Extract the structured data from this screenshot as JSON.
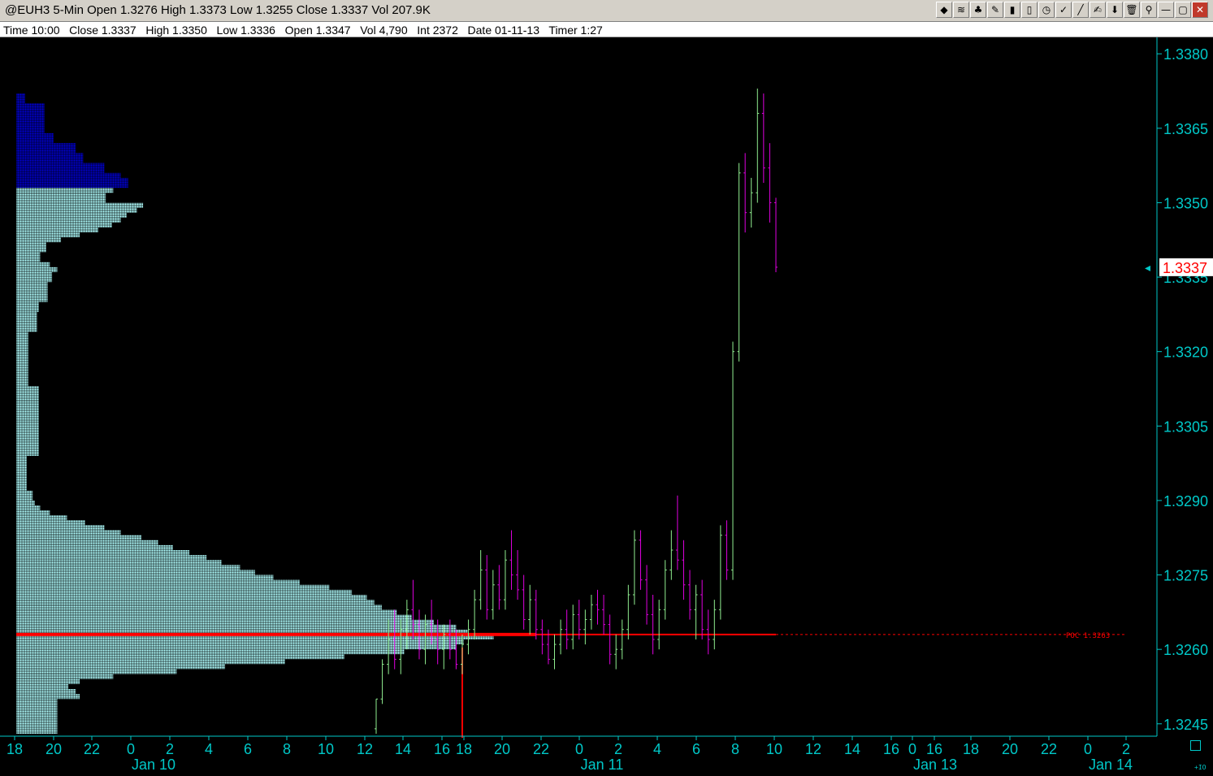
{
  "window": {
    "title": "@EUH3 5-Min Open 1.3276 High 1.3373 Low 1.3255 Close 1.3337 Vol 207.9K",
    "toolbar_icons": [
      "chart-icon",
      "wave-icon",
      "tree-icon",
      "pencil-icon",
      "bars-icon",
      "candle-icon",
      "clock-icon",
      "check-icon",
      "line-tool-icon",
      "draw-icon",
      "arrow-down-icon",
      "trash-icon",
      "pin-icon",
      "minimize-icon",
      "maximize-icon",
      "close-icon"
    ],
    "toolbar_glyphs": [
      "◆",
      "≋",
      "♣",
      "✎",
      "▮",
      "▯",
      "◷",
      "✓",
      "╱",
      "✍",
      "⬇",
      "🗑",
      "⚲",
      "—",
      "▢",
      "✕"
    ]
  },
  "infobar": {
    "text": "Time 10:00   Close 1.3337   High 1.3350   Low 1.3336   Open 1.3347   Vol 4,790   Int 2372   Date 01-11-13   Timer 1:27"
  },
  "colors": {
    "background": "#000000",
    "axis": "#00c8c8",
    "profile_light": "#aefcfc",
    "profile_dark": "#0000d0",
    "up_bar": "#90ee90",
    "down_bar": "#e000e0",
    "poc_line": "#ff0000"
  },
  "chart_data": {
    "type": "candlestick-with-volume-profile",
    "symbol": "@EUH3",
    "interval": "5-Min",
    "ylim": [
      1.3243,
      1.3382
    ],
    "yticks": [
      "1.3380",
      "1.3365",
      "1.3350",
      "1.3335",
      "1.3320",
      "1.3305",
      "1.3290",
      "1.3275",
      "1.3260",
      "1.3245"
    ],
    "last_price": "1.3337",
    "last_price_value": 1.3337,
    "poc_label": "POC 1.3263",
    "poc_value": 1.3263,
    "xticks": [
      "18",
      "20",
      "22",
      "0",
      "2",
      "4",
      "6",
      "8",
      "10",
      "12",
      "14",
      "16",
      "18",
      "20",
      "22",
      "0",
      "2",
      "4",
      "6",
      "8",
      "10",
      "12",
      "14",
      "16",
      "0",
      "16",
      "18",
      "20",
      "22",
      "0",
      "2"
    ],
    "date_labels": [
      "Jan 10",
      "Jan 11",
      "Jan 13",
      "Jan 14"
    ],
    "volume_profile": [
      {
        "price": 1.3372,
        "volume": 12,
        "zone": "dark"
      },
      {
        "price": 1.337,
        "volume": 38,
        "zone": "dark"
      },
      {
        "price": 1.3368,
        "volume": 38,
        "zone": "dark"
      },
      {
        "price": 1.3366,
        "volume": 38,
        "zone": "dark"
      },
      {
        "price": 1.3364,
        "volume": 50,
        "zone": "dark"
      },
      {
        "price": 1.3362,
        "volume": 80,
        "zone": "dark"
      },
      {
        "price": 1.336,
        "volume": 90,
        "zone": "dark"
      },
      {
        "price": 1.3358,
        "volume": 118,
        "zone": "dark"
      },
      {
        "price": 1.3356,
        "volume": 140,
        "zone": "dark"
      },
      {
        "price": 1.3355,
        "volume": 150,
        "zone": "dark"
      },
      {
        "price": 1.3353,
        "volume": 130,
        "zone": "light"
      },
      {
        "price": 1.3352,
        "volume": 120,
        "zone": "light"
      },
      {
        "price": 1.335,
        "volume": 170,
        "zone": "light"
      },
      {
        "price": 1.3349,
        "volume": 162,
        "zone": "light"
      },
      {
        "price": 1.3348,
        "volume": 148,
        "zone": "light"
      },
      {
        "price": 1.3347,
        "volume": 140,
        "zone": "light"
      },
      {
        "price": 1.3346,
        "volume": 128,
        "zone": "light"
      },
      {
        "price": 1.3345,
        "volume": 110,
        "zone": "light"
      },
      {
        "price": 1.3344,
        "volume": 85,
        "zone": "light"
      },
      {
        "price": 1.3343,
        "volume": 60,
        "zone": "light"
      },
      {
        "price": 1.3342,
        "volume": 40,
        "zone": "light"
      },
      {
        "price": 1.334,
        "volume": 32,
        "zone": "light"
      },
      {
        "price": 1.3338,
        "volume": 45,
        "zone": "light"
      },
      {
        "price": 1.3337,
        "volume": 55,
        "zone": "light"
      },
      {
        "price": 1.3336,
        "volume": 48,
        "zone": "light"
      },
      {
        "price": 1.3334,
        "volume": 42,
        "zone": "light"
      },
      {
        "price": 1.3332,
        "volume": 42,
        "zone": "light"
      },
      {
        "price": 1.333,
        "volume": 30,
        "zone": "light"
      },
      {
        "price": 1.3328,
        "volume": 28,
        "zone": "light"
      },
      {
        "price": 1.3326,
        "volume": 28,
        "zone": "light"
      },
      {
        "price": 1.3324,
        "volume": 16,
        "zone": "light"
      },
      {
        "price": 1.332,
        "volume": 16,
        "zone": "light"
      },
      {
        "price": 1.3316,
        "volume": 16,
        "zone": "light"
      },
      {
        "price": 1.3313,
        "volume": 30,
        "zone": "light"
      },
      {
        "price": 1.331,
        "volume": 30,
        "zone": "light"
      },
      {
        "price": 1.3306,
        "volume": 30,
        "zone": "light"
      },
      {
        "price": 1.3302,
        "volume": 30,
        "zone": "light"
      },
      {
        "price": 1.3299,
        "volume": 14,
        "zone": "light"
      },
      {
        "price": 1.3295,
        "volume": 14,
        "zone": "light"
      },
      {
        "price": 1.3292,
        "volume": 22,
        "zone": "light"
      },
      {
        "price": 1.329,
        "volume": 25,
        "zone": "light"
      },
      {
        "price": 1.3289,
        "volume": 32,
        "zone": "light"
      },
      {
        "price": 1.3288,
        "volume": 45,
        "zone": "light"
      },
      {
        "price": 1.3287,
        "volume": 68,
        "zone": "light"
      },
      {
        "price": 1.3286,
        "volume": 92,
        "zone": "light"
      },
      {
        "price": 1.3285,
        "volume": 118,
        "zone": "light"
      },
      {
        "price": 1.3284,
        "volume": 140,
        "zone": "light"
      },
      {
        "price": 1.3283,
        "volume": 168,
        "zone": "light"
      },
      {
        "price": 1.3282,
        "volume": 190,
        "zone": "light"
      },
      {
        "price": 1.3281,
        "volume": 210,
        "zone": "light"
      },
      {
        "price": 1.328,
        "volume": 232,
        "zone": "light"
      },
      {
        "price": 1.3279,
        "volume": 255,
        "zone": "light"
      },
      {
        "price": 1.3278,
        "volume": 275,
        "zone": "light"
      },
      {
        "price": 1.3277,
        "volume": 300,
        "zone": "light"
      },
      {
        "price": 1.3276,
        "volume": 320,
        "zone": "light"
      },
      {
        "price": 1.3275,
        "volume": 345,
        "zone": "light"
      },
      {
        "price": 1.3274,
        "volume": 380,
        "zone": "light"
      },
      {
        "price": 1.3273,
        "volume": 420,
        "zone": "light"
      },
      {
        "price": 1.3272,
        "volume": 450,
        "zone": "light"
      },
      {
        "price": 1.3271,
        "volume": 470,
        "zone": "light"
      },
      {
        "price": 1.327,
        "volume": 480,
        "zone": "light"
      },
      {
        "price": 1.3269,
        "volume": 490,
        "zone": "light"
      },
      {
        "price": 1.3268,
        "volume": 510,
        "zone": "light"
      },
      {
        "price": 1.3267,
        "volume": 530,
        "zone": "light"
      },
      {
        "price": 1.3266,
        "volume": 560,
        "zone": "light"
      },
      {
        "price": 1.3265,
        "volume": 590,
        "zone": "light"
      },
      {
        "price": 1.3264,
        "volume": 605,
        "zone": "light"
      },
      {
        "price": 1.3263,
        "volume": 640,
        "zone": "light"
      },
      {
        "price": 1.3262,
        "volume": 600,
        "zone": "light"
      },
      {
        "price": 1.3261,
        "volume": 590,
        "zone": "light"
      },
      {
        "price": 1.326,
        "volume": 520,
        "zone": "light"
      },
      {
        "price": 1.3259,
        "volume": 440,
        "zone": "light"
      },
      {
        "price": 1.3258,
        "volume": 360,
        "zone": "light"
      },
      {
        "price": 1.3257,
        "volume": 280,
        "zone": "light"
      },
      {
        "price": 1.3256,
        "volume": 215,
        "zone": "light"
      },
      {
        "price": 1.3255,
        "volume": 130,
        "zone": "light"
      },
      {
        "price": 1.3254,
        "volume": 85,
        "zone": "light"
      },
      {
        "price": 1.3253,
        "volume": 70,
        "zone": "light"
      },
      {
        "price": 1.3252,
        "volume": 80,
        "zone": "light"
      },
      {
        "price": 1.3251,
        "volume": 85,
        "zone": "light"
      },
      {
        "price": 1.325,
        "volume": 55,
        "zone": "light"
      },
      {
        "price": 1.3248,
        "volume": 55,
        "zone": "light"
      },
      {
        "price": 1.3246,
        "volume": 55,
        "zone": "light"
      },
      {
        "price": 1.3244,
        "volume": 55,
        "zone": "light"
      }
    ],
    "bars": [
      [
        1.3244,
        1.325,
        1.3243,
        1.325
      ],
      [
        1.325,
        1.3258,
        1.3249,
        1.3257
      ],
      [
        1.3257,
        1.3266,
        1.3255,
        1.3262
      ],
      [
        1.3262,
        1.3268,
        1.3256,
        1.3258
      ],
      [
        1.3258,
        1.3266,
        1.3255,
        1.3264
      ],
      [
        1.3264,
        1.327,
        1.326,
        1.3268
      ],
      [
        1.3268,
        1.3274,
        1.3262,
        1.3265
      ],
      [
        1.3265,
        1.3268,
        1.3258,
        1.326
      ],
      [
        1.326,
        1.3267,
        1.3257,
        1.3265
      ],
      [
        1.3265,
        1.327,
        1.3261,
        1.3262
      ],
      [
        1.3262,
        1.3266,
        1.3257,
        1.326
      ],
      [
        1.326,
        1.3265,
        1.3256,
        1.3263
      ],
      [
        1.3263,
        1.3266,
        1.3258,
        1.326
      ],
      [
        1.326,
        1.3264,
        1.3256,
        1.3257
      ],
      [
        1.3257,
        1.3263,
        1.3255,
        1.3261
      ],
      [
        1.3261,
        1.3266,
        1.3259,
        1.3264
      ],
      [
        1.3264,
        1.3272,
        1.3262,
        1.327
      ],
      [
        1.327,
        1.328,
        1.3268,
        1.3276
      ],
      [
        1.3276,
        1.3279,
        1.3266,
        1.3268
      ],
      [
        1.3268,
        1.3276,
        1.3266,
        1.3273
      ],
      [
        1.3273,
        1.3277,
        1.3268,
        1.327
      ],
      [
        1.327,
        1.328,
        1.3268,
        1.3278
      ],
      [
        1.3278,
        1.3284,
        1.3272,
        1.3275
      ],
      [
        1.3275,
        1.328,
        1.327,
        1.3272
      ],
      [
        1.3272,
        1.3275,
        1.3264,
        1.3266
      ],
      [
        1.3266,
        1.3273,
        1.3263,
        1.327
      ],
      [
        1.327,
        1.3272,
        1.3262,
        1.3264
      ],
      [
        1.3264,
        1.3266,
        1.3259,
        1.3261
      ],
      [
        1.3261,
        1.3264,
        1.3257,
        1.3258
      ],
      [
        1.3258,
        1.3263,
        1.3256,
        1.3261
      ],
      [
        1.3261,
        1.3266,
        1.3259,
        1.3264
      ],
      [
        1.3264,
        1.3268,
        1.326,
        1.3262
      ],
      [
        1.3262,
        1.3269,
        1.326,
        1.3267
      ],
      [
        1.3267,
        1.327,
        1.3262,
        1.3264
      ],
      [
        1.3264,
        1.3268,
        1.3261,
        1.3266
      ],
      [
        1.3266,
        1.3271,
        1.3264,
        1.3269
      ],
      [
        1.3269,
        1.3272,
        1.3265,
        1.3268
      ],
      [
        1.3268,
        1.3271,
        1.3263,
        1.3265
      ],
      [
        1.3265,
        1.3267,
        1.3257,
        1.3259
      ],
      [
        1.3259,
        1.3263,
        1.3256,
        1.326
      ],
      [
        1.326,
        1.3266,
        1.3258,
        1.3264
      ],
      [
        1.3264,
        1.3273,
        1.3262,
        1.3271
      ],
      [
        1.3271,
        1.3284,
        1.3269,
        1.3282
      ],
      [
        1.3282,
        1.3284,
        1.3272,
        1.3274
      ],
      [
        1.3274,
        1.3277,
        1.3265,
        1.3267
      ],
      [
        1.3267,
        1.3271,
        1.3259,
        1.3262
      ],
      [
        1.3262,
        1.327,
        1.326,
        1.3268
      ],
      [
        1.3268,
        1.3278,
        1.3266,
        1.3276
      ],
      [
        1.3276,
        1.3284,
        1.3274,
        1.328
      ],
      [
        1.328,
        1.3291,
        1.3276,
        1.3278
      ],
      [
        1.3278,
        1.3282,
        1.327,
        1.3273
      ],
      [
        1.3273,
        1.3276,
        1.3266,
        1.3268
      ],
      [
        1.3268,
        1.3273,
        1.3262,
        1.3271
      ],
      [
        1.3271,
        1.3274,
        1.3262,
        1.3264
      ],
      [
        1.3264,
        1.3268,
        1.3259,
        1.3262
      ],
      [
        1.3262,
        1.327,
        1.326,
        1.3268
      ],
      [
        1.3268,
        1.3285,
        1.3266,
        1.3283
      ],
      [
        1.3283,
        1.3286,
        1.3274,
        1.3276
      ],
      [
        1.3276,
        1.3322,
        1.3274,
        1.332
      ],
      [
        1.332,
        1.3358,
        1.3318,
        1.3356
      ],
      [
        1.3356,
        1.336,
        1.3344,
        1.3348
      ],
      [
        1.3348,
        1.3355,
        1.3345,
        1.3352
      ],
      [
        1.3352,
        1.3373,
        1.335,
        1.3368
      ],
      [
        1.3368,
        1.3372,
        1.3354,
        1.3357
      ],
      [
        1.3357,
        1.3362,
        1.3346,
        1.335
      ],
      [
        1.335,
        1.3351,
        1.3336,
        1.3337
      ]
    ]
  }
}
